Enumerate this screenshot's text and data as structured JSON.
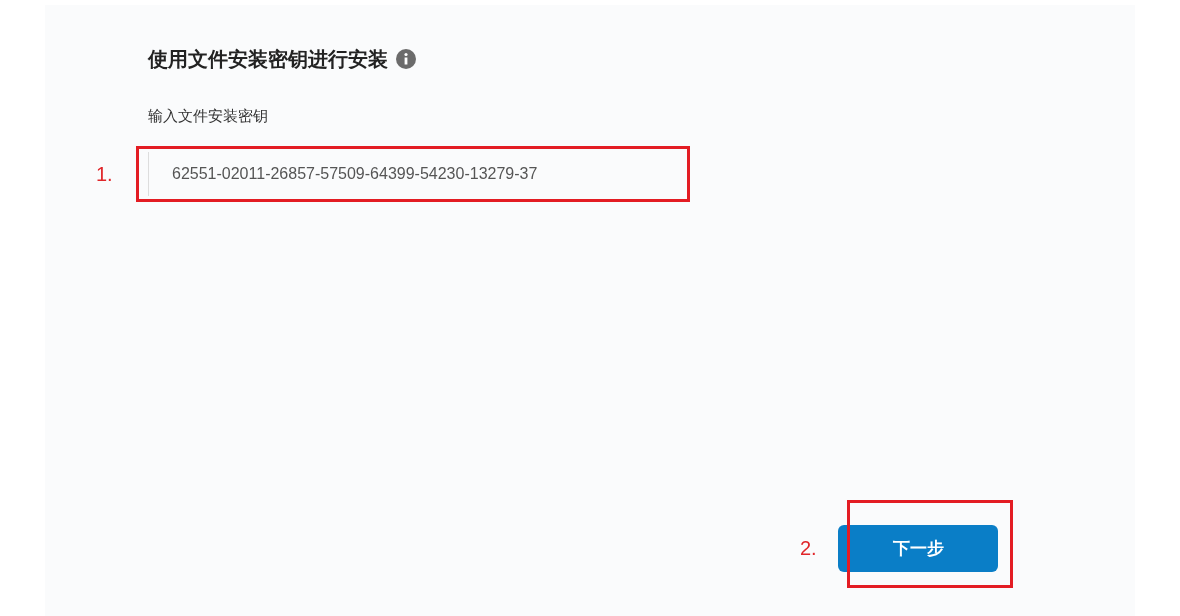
{
  "title": "使用文件安装密钥进行安装",
  "field": {
    "label": "输入文件安装密钥",
    "value": "62551-02011-26857-57509-64399-54230-13279-37",
    "annotation": "1."
  },
  "next_button": {
    "label": "下一步",
    "annotation": "2."
  }
}
